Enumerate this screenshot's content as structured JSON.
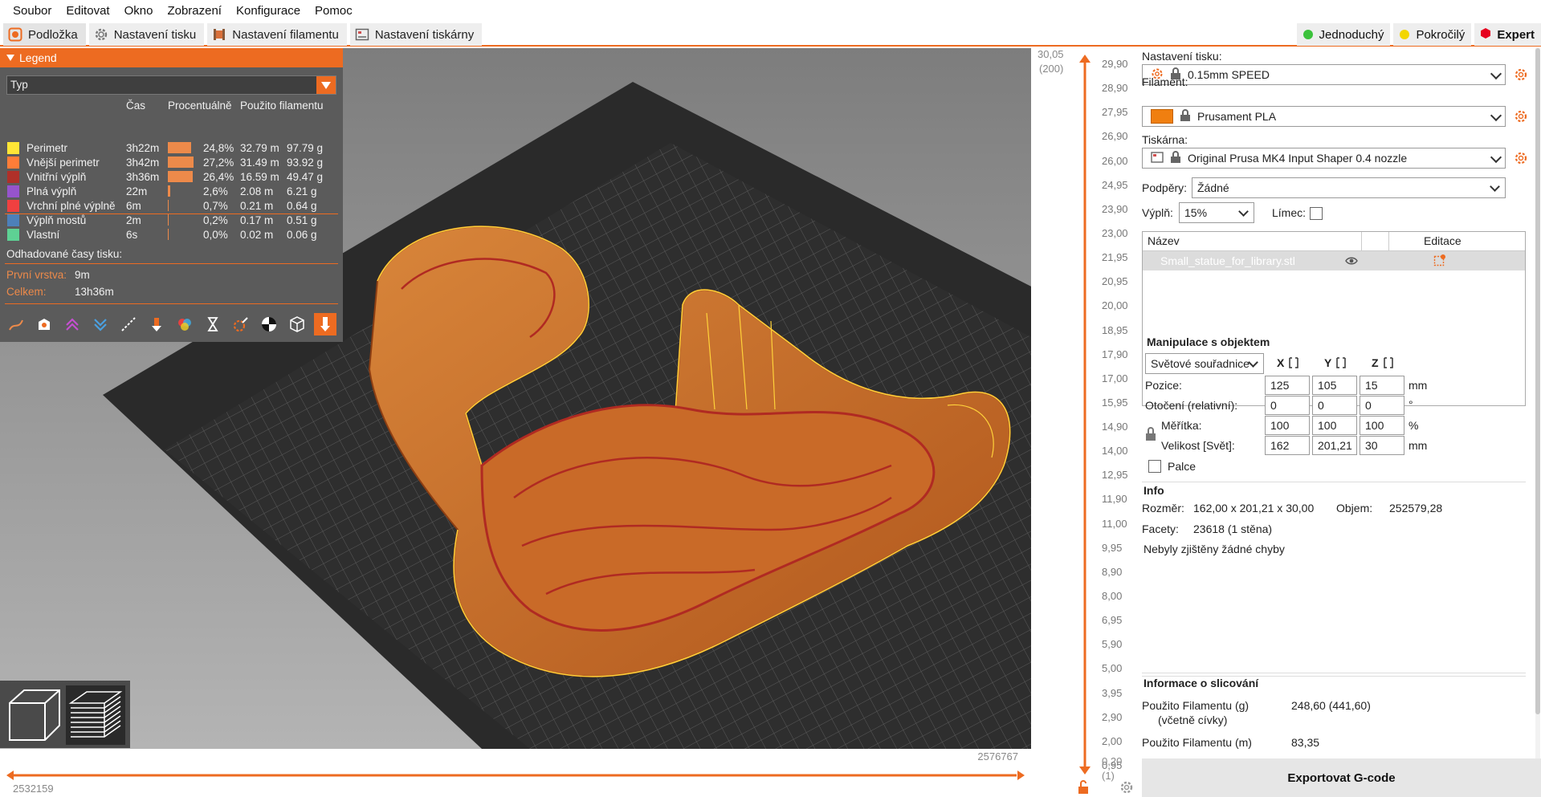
{
  "menu": [
    "Soubor",
    "Editovat",
    "Okno",
    "Zobrazení",
    "Konfigurace",
    "Pomoc"
  ],
  "tabs": [
    {
      "label": "Podložka",
      "icon": "plater-icon",
      "active": true
    },
    {
      "label": "Nastavení tisku",
      "icon": "gear-icon"
    },
    {
      "label": "Nastavení filamentu",
      "icon": "spool-icon"
    },
    {
      "label": "Nastavení tiskárny",
      "icon": "printer-icon"
    }
  ],
  "modes": [
    {
      "label": "Jednoduchý",
      "color": "#3cc23c"
    },
    {
      "label": "Pokročilý",
      "color": "#f2d600"
    },
    {
      "label": "Expert",
      "color": "#e6001f",
      "active": true
    }
  ],
  "legend": {
    "title": "Legend",
    "view_type": "Typ",
    "columns": [
      "Čas",
      "Procentuálně",
      "Použito filamentu"
    ],
    "rows": [
      {
        "name": "Perimetr",
        "color": "#ffe636",
        "time": "3h22m",
        "percent": "24,8%",
        "fraction": 0.248,
        "length": "32.79 m",
        "weight": "97.79 g"
      },
      {
        "name": "Vnější perimetr",
        "color": "#ff7d38",
        "time": "3h42m",
        "percent": "27,2%",
        "fraction": 0.272,
        "length": "31.49 m",
        "weight": "93.92 g"
      },
      {
        "name": "Vnitřní výplň",
        "color": "#b03029",
        "time": "3h36m",
        "percent": "26,4%",
        "fraction": 0.264,
        "length": "16.59 m",
        "weight": "49.47 g"
      },
      {
        "name": "Plná výplň",
        "color": "#9654cc",
        "time": "22m",
        "percent": "2,6%",
        "fraction": 0.026,
        "length": "2.08 m",
        "weight": "6.21 g"
      },
      {
        "name": "Vrchní plné výplně",
        "color": "#f04040",
        "time": "6m",
        "percent": "0,7%",
        "fraction": 0.007,
        "length": "0.21 m",
        "weight": "0.64 g"
      },
      {
        "name": "Výplň mostů",
        "color": "#4d80ba",
        "time": "2m",
        "percent": "0,2%",
        "fraction": 0.002,
        "length": "0.17 m",
        "weight": "0.51 g"
      },
      {
        "name": "Vlastní",
        "color": "#5ed194",
        "time": "6s",
        "percent": "0,0%",
        "fraction": 0.0,
        "length": "0.02 m",
        "weight": "0.06 g"
      }
    ],
    "estimated_label": "Odhadované časy tisku:",
    "first_layer_label": "První vrstva:",
    "first_layer_value": "9m",
    "total_label": "Celkem:",
    "total_value": "13h36m"
  },
  "timeline": {
    "right_value": "2576767",
    "left_value": "2532159"
  },
  "vslider": {
    "top_value": "30,05",
    "top_layer": "(200)",
    "bottom_value": "0,20",
    "bottom_layer": "(1)",
    "ticks": [
      "29,90",
      "28,90",
      "27,95",
      "26,90",
      "26,00",
      "24,95",
      "23,90",
      "23,00",
      "21,95",
      "20,95",
      "20,00",
      "18,95",
      "17,90",
      "17,00",
      "15,95",
      "14,90",
      "14,00",
      "12,95",
      "11,90",
      "11,00",
      "9,95",
      "8,90",
      "8,00",
      "6,95",
      "5,90",
      "5,00",
      "3,95",
      "2,90",
      "2,00",
      "0,95"
    ]
  },
  "panel": {
    "print_settings_label": "Nastavení tisku:",
    "print_settings_value": "0.15mm SPEED",
    "filament_label": "Filament:",
    "filament_value": "Prusament PLA",
    "filament_color": "#f07f10",
    "printer_label": "Tiskárna:",
    "printer_value": "Original Prusa MK4 Input Shaper 0.4 nozzle",
    "supports_label": "Podpěry:",
    "supports_value": "Žádné",
    "infill_label": "Výplň:",
    "infill_value": "15%",
    "brim_label": "Límec:",
    "list_col_name": "Název",
    "list_col_edit": "Editace",
    "object_name": "Small_statue_for_library.stl"
  },
  "manipulation": {
    "title": "Manipulace s objektem",
    "coords": "Světové souřadnice",
    "axes": [
      "X",
      "Y",
      "Z"
    ],
    "position_label": "Pozice:",
    "position": [
      "125",
      "105",
      "15"
    ],
    "position_unit": "mm",
    "rotation_label": "Otočení (relativní):",
    "rotation": [
      "0",
      "0",
      "0"
    ],
    "rotation_unit": "°",
    "scale_label": "Měřítka:",
    "scale": [
      "100",
      "100",
      "100"
    ],
    "scale_unit": "%",
    "size_label": "Velikost [Svět]:",
    "size": [
      "162",
      "201,21",
      "30"
    ],
    "size_unit": "mm",
    "inches_label": "Palce"
  },
  "info": {
    "title": "Info",
    "size_label": "Rozměr:",
    "size_value": "162,00 x 201,21 x 30,00",
    "volume_label": "Objem:",
    "volume_value": "252579,28",
    "facets_label": "Facety:",
    "facets_value": "23618 (1 stěna)",
    "errors": "Nebyly zjištěny žádné chyby"
  },
  "slicing": {
    "title": "Informace o slicování",
    "filament_g_label": "Použito Filamentu (g)",
    "filament_g_sub": "(včetně cívky)",
    "filament_g_value": "248,60 (441,60)",
    "filament_m_label": "Použito Filamentu (m)",
    "filament_m_value": "83,35"
  },
  "export_label": "Exportovat G-code",
  "accent_color": "#ed6b21"
}
